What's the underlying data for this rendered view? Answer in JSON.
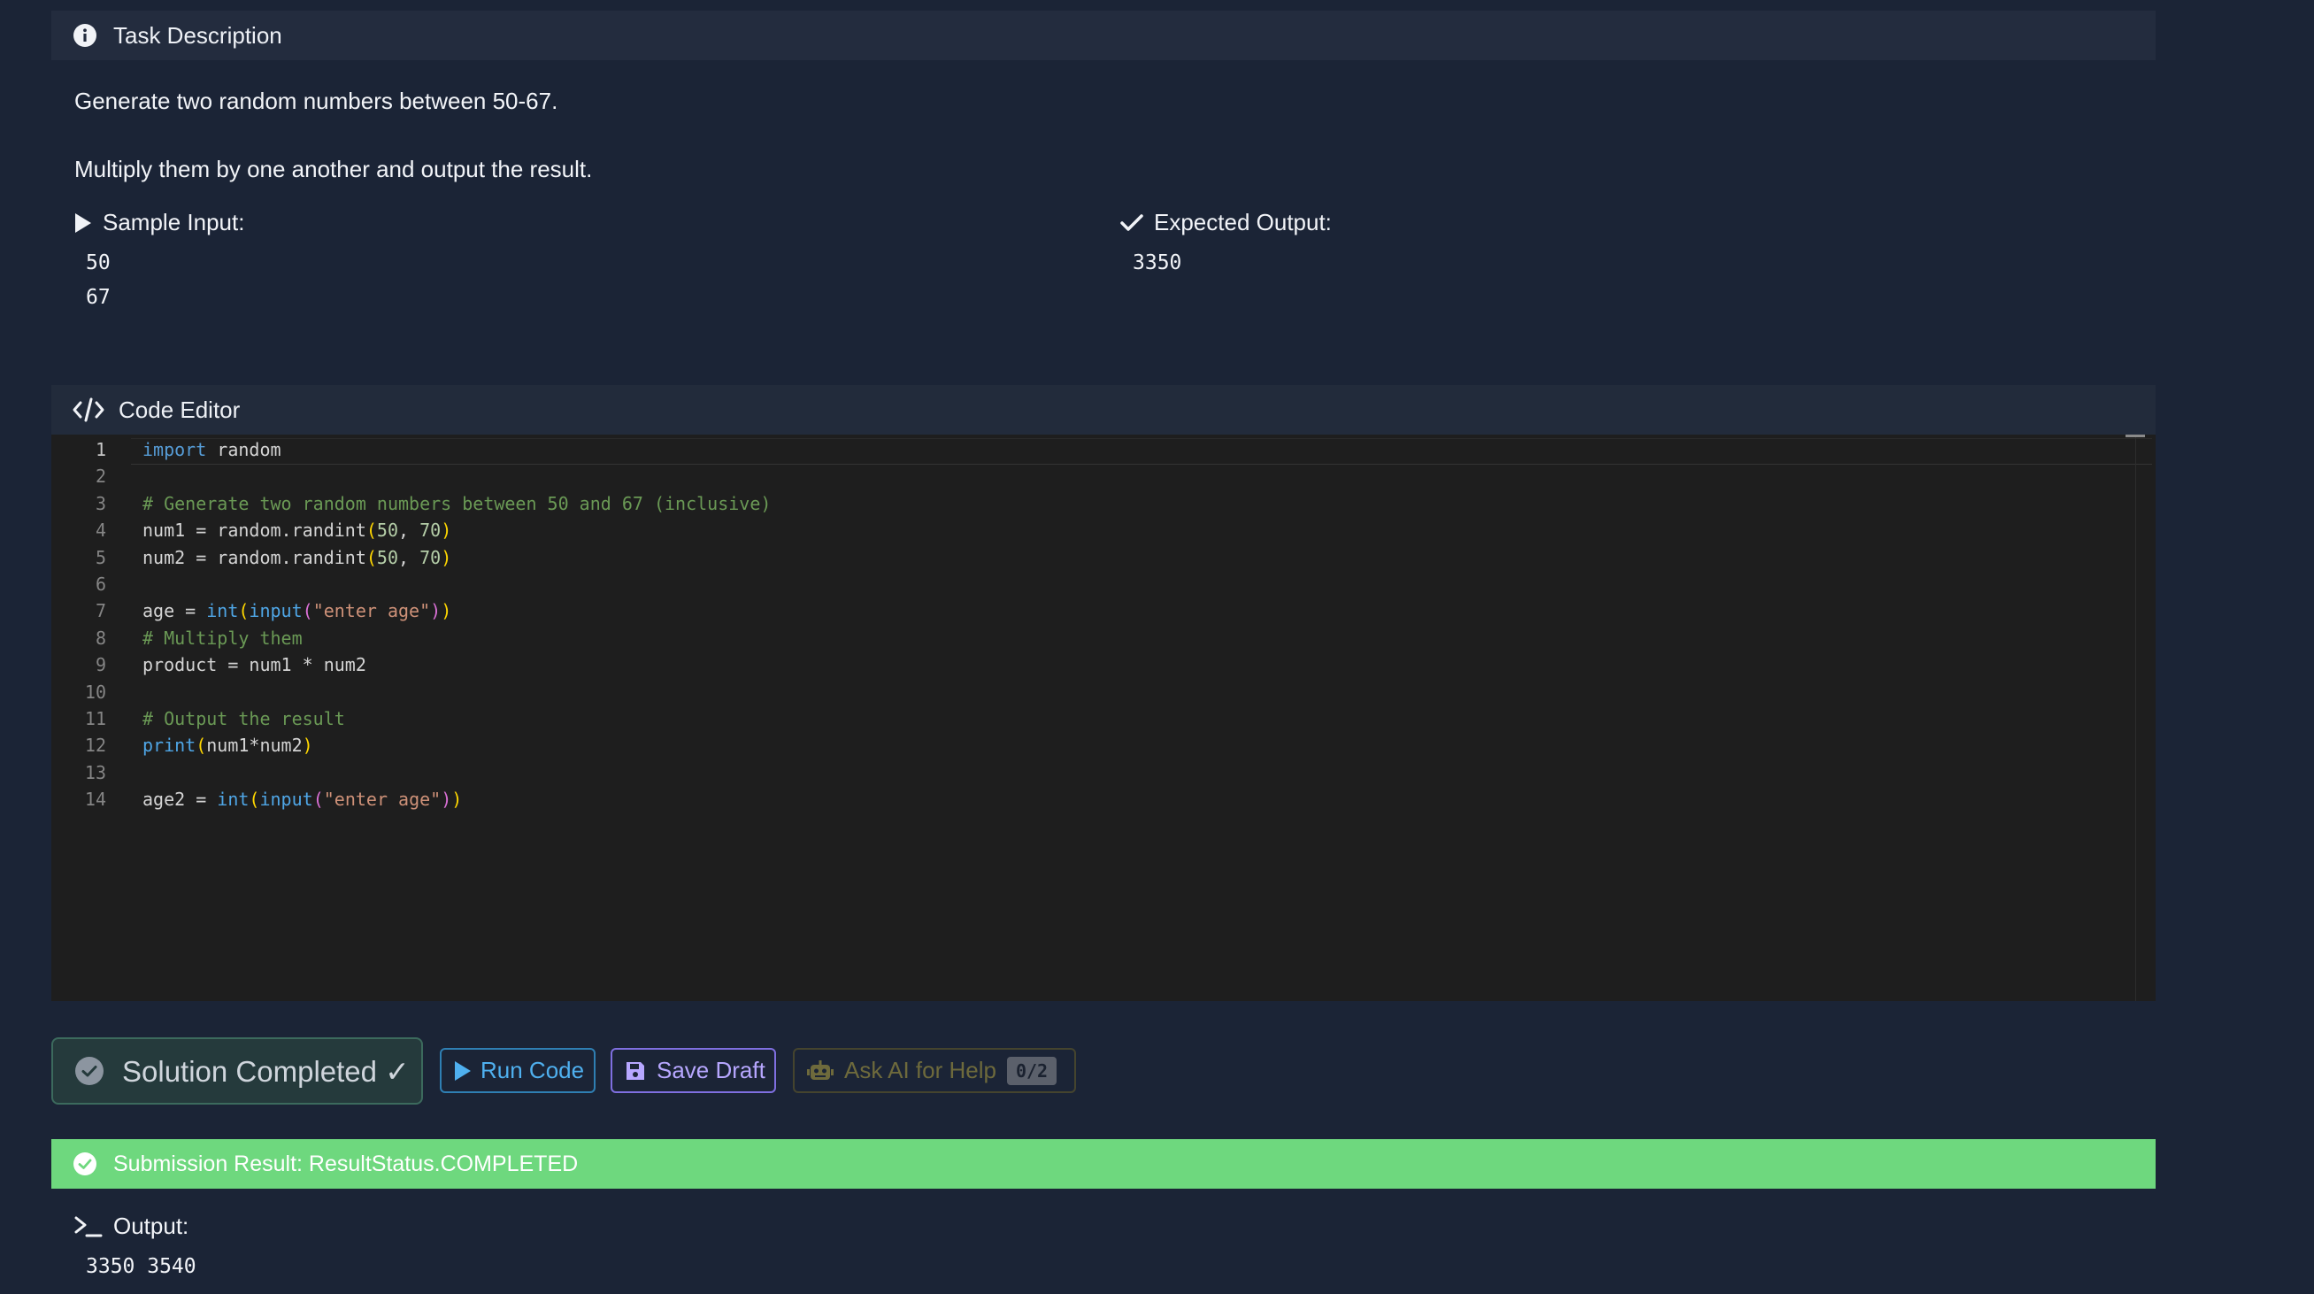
{
  "task": {
    "header": "Task Description",
    "description_line1": "Generate two random numbers between 50-67.",
    "description_line2": "Multiply them by one another and output the result.",
    "sample_input_label": "Sample Input:",
    "sample_input_values": [
      "50",
      "67"
    ],
    "expected_output_label": "Expected Output:",
    "expected_output_value": "3350"
  },
  "editor": {
    "header": "Code Editor",
    "lines": [
      "import random",
      "",
      "# Generate two random numbers between 50 and 67 (inclusive)",
      "num1 = random.randint(50, 70)",
      "num2 = random.randint(50, 70)",
      "",
      "age = int(input(\"enter age\"))",
      "# Multiply them",
      "product = num1 * num2",
      "",
      "# Output the result",
      "print(num1*num2)",
      "",
      "age2 = int(input(\"enter age\"))"
    ]
  },
  "actions": {
    "solution_label": "Solution Completed ✓",
    "run_label": "Run Code",
    "save_label": "Save Draft",
    "ai_label": "Ask AI for Help",
    "ai_counter": "0/2"
  },
  "result": {
    "status_text": "Submission Result: ResultStatus.COMPLETED",
    "output_label": "Output:",
    "output_value": "3350 3540"
  },
  "colors": {
    "background": "#1b2436",
    "success_bar": "#6ed87e",
    "run_accent": "#4fb0ef",
    "save_accent": "#b7a7ff"
  },
  "icons": {
    "task_header": "info-circle-icon",
    "sample_input": "play-triangle-icon",
    "expected_output": "check-icon",
    "editor_header": "code-brackets-icon",
    "solution": "check-circle-icon",
    "run": "play-icon",
    "save": "floppy-disk-icon",
    "ai": "robot-icon",
    "result": "check-circle-icon",
    "output": "terminal-prompt-icon"
  }
}
